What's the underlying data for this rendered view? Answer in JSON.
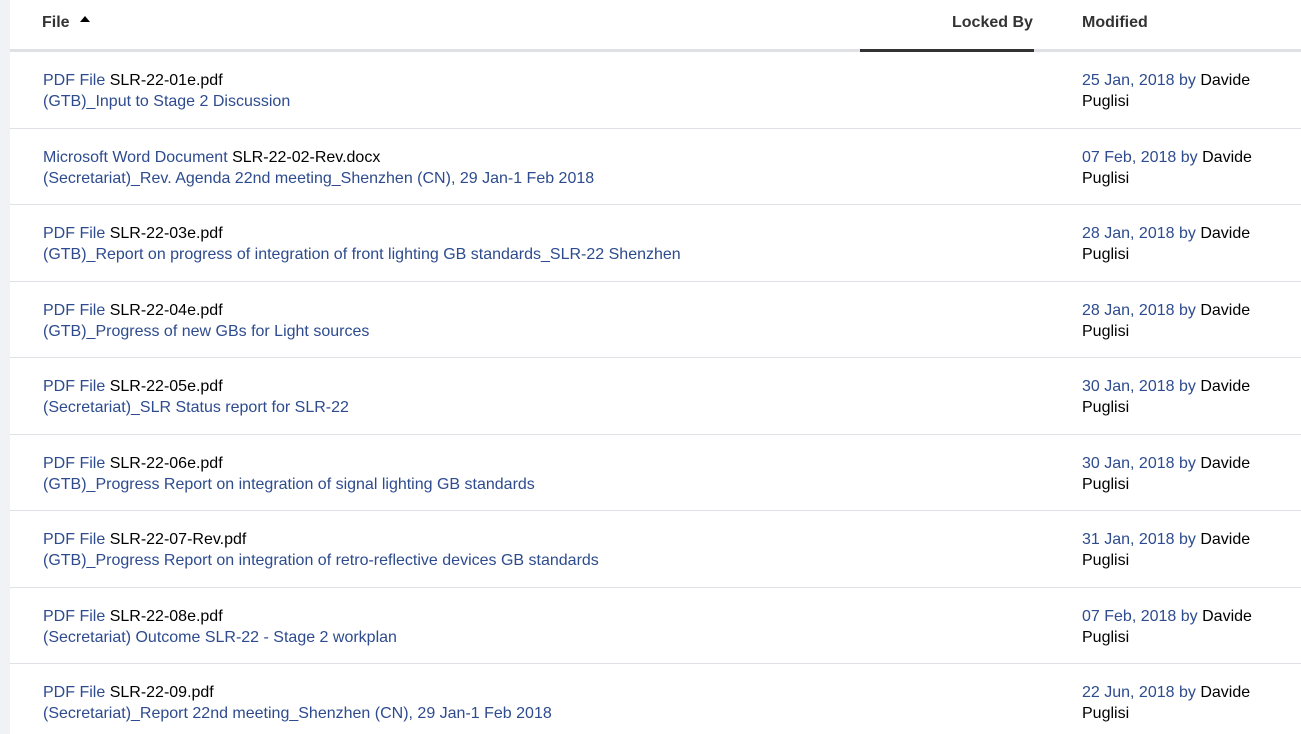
{
  "header": {
    "file_label": "File",
    "locked_label": "Locked By",
    "modified_label": "Modified"
  },
  "rows": [
    {
      "type": "PDF File",
      "name": "SLR-22-01e.pdf",
      "desc": "(GTB)_Input to Stage 2 Discussion",
      "date": "25 Jan, 2018",
      "by": "by",
      "user_first": "Davide",
      "user_last": "Puglisi"
    },
    {
      "type": "Microsoft Word Document",
      "name": "SLR-22-02-Rev.docx",
      "desc": "(Secretariat)_Rev. Agenda 22nd meeting_Shenzhen (CN), 29 Jan-1 Feb 2018",
      "date": "07 Feb, 2018",
      "by": "by",
      "user_first": "Davide",
      "user_last": "Puglisi"
    },
    {
      "type": "PDF File",
      "name": "SLR-22-03e.pdf",
      "desc": "(GTB)_Report on progress of integration of front lighting GB standards_SLR-22 Shenzhen",
      "date": "28 Jan, 2018",
      "by": "by",
      "user_first": "Davide",
      "user_last": "Puglisi"
    },
    {
      "type": "PDF File",
      "name": "SLR-22-04e.pdf",
      "desc": "(GTB)_Progress of new GBs for Light sources",
      "date": "28 Jan, 2018",
      "by": "by",
      "user_first": "Davide",
      "user_last": "Puglisi"
    },
    {
      "type": "PDF File",
      "name": "SLR-22-05e.pdf",
      "desc": "(Secretariat)_SLR Status report for SLR-22",
      "date": "30 Jan, 2018",
      "by": "by",
      "user_first": "Davide",
      "user_last": "Puglisi"
    },
    {
      "type": "PDF File",
      "name": "SLR-22-06e.pdf",
      "desc": "(GTB)_Progress Report on integration of signal lighting GB standards",
      "date": "30 Jan, 2018",
      "by": "by",
      "user_first": "Davide",
      "user_last": "Puglisi"
    },
    {
      "type": "PDF File",
      "name": "SLR-22-07-Rev.pdf",
      "desc": "(GTB)_Progress Report on integration of retro-reflective devices GB standards",
      "date": "31 Jan, 2018",
      "by": "by",
      "user_first": "Davide",
      "user_last": "Puglisi"
    },
    {
      "type": "PDF File",
      "name": "SLR-22-08e.pdf",
      "desc": "(Secretariat) Outcome SLR-22 - Stage 2 workplan",
      "date": "07 Feb, 2018",
      "by": "by",
      "user_first": "Davide",
      "user_last": "Puglisi"
    },
    {
      "type": "PDF File",
      "name": "SLR-22-09.pdf",
      "desc": "(Secretariat)_Report 22nd meeting_Shenzhen (CN), 29 Jan-1 Feb 2018",
      "date": "22 Jun, 2018",
      "by": "by",
      "user_first": "Davide",
      "user_last": "Puglisi"
    }
  ]
}
